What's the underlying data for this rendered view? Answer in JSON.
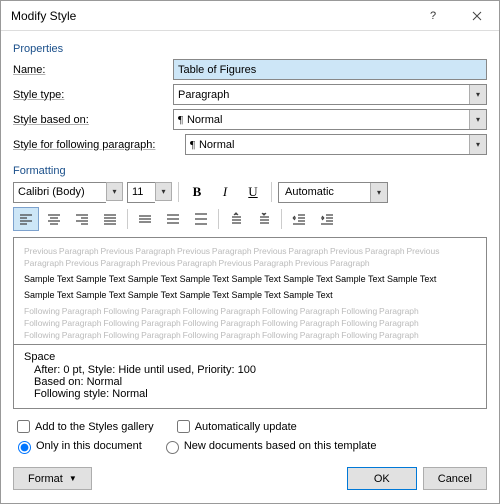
{
  "titlebar": {
    "title": "Modify Style"
  },
  "section": {
    "properties": "Properties",
    "formatting": "Formatting"
  },
  "labels": {
    "name": "Name:",
    "styleType": "Style type:",
    "basedOn": "Style based on:",
    "following": "Style for following paragraph:"
  },
  "values": {
    "name": "Table of Figures",
    "styleType": "Paragraph",
    "basedOn": "Normal",
    "following": "Normal"
  },
  "toolbar": {
    "font": "Calibri (Body)",
    "size": "11",
    "bold": "B",
    "italic": "I",
    "underline": "U",
    "color": "Automatic"
  },
  "preview": {
    "ghost1": "Previous Paragraph Previous Paragraph Previous Paragraph Previous Paragraph Previous Paragraph Previous",
    "ghost2": "Paragraph Previous Paragraph Previous Paragraph Previous Paragraph Previous Paragraph",
    "sample1": "Sample Text Sample Text Sample Text Sample Text Sample Text Sample Text Sample Text Sample Text",
    "sample2": "Sample Text Sample Text Sample Text Sample Text Sample Text Sample Text",
    "ghost3": "Following Paragraph Following Paragraph Following Paragraph Following Paragraph Following Paragraph",
    "ghost4": "Following Paragraph Following Paragraph Following Paragraph Following Paragraph Following Paragraph",
    "ghost5": "Following Paragraph Following Paragraph Following Paragraph Following Paragraph Following Paragraph"
  },
  "desc": {
    "head": "Space",
    "line1": "After:  0 pt, Style: Hide until used, Priority: 100",
    "line2": "Based on: Normal",
    "line3": "Following style: Normal"
  },
  "checks": {
    "gallery": "Add to the Styles gallery",
    "auto": "Automatically update",
    "onlydoc": "Only in this document",
    "template": "New documents based on this template"
  },
  "buttons": {
    "format": "Format",
    "ok": "OK",
    "cancel": "Cancel"
  }
}
